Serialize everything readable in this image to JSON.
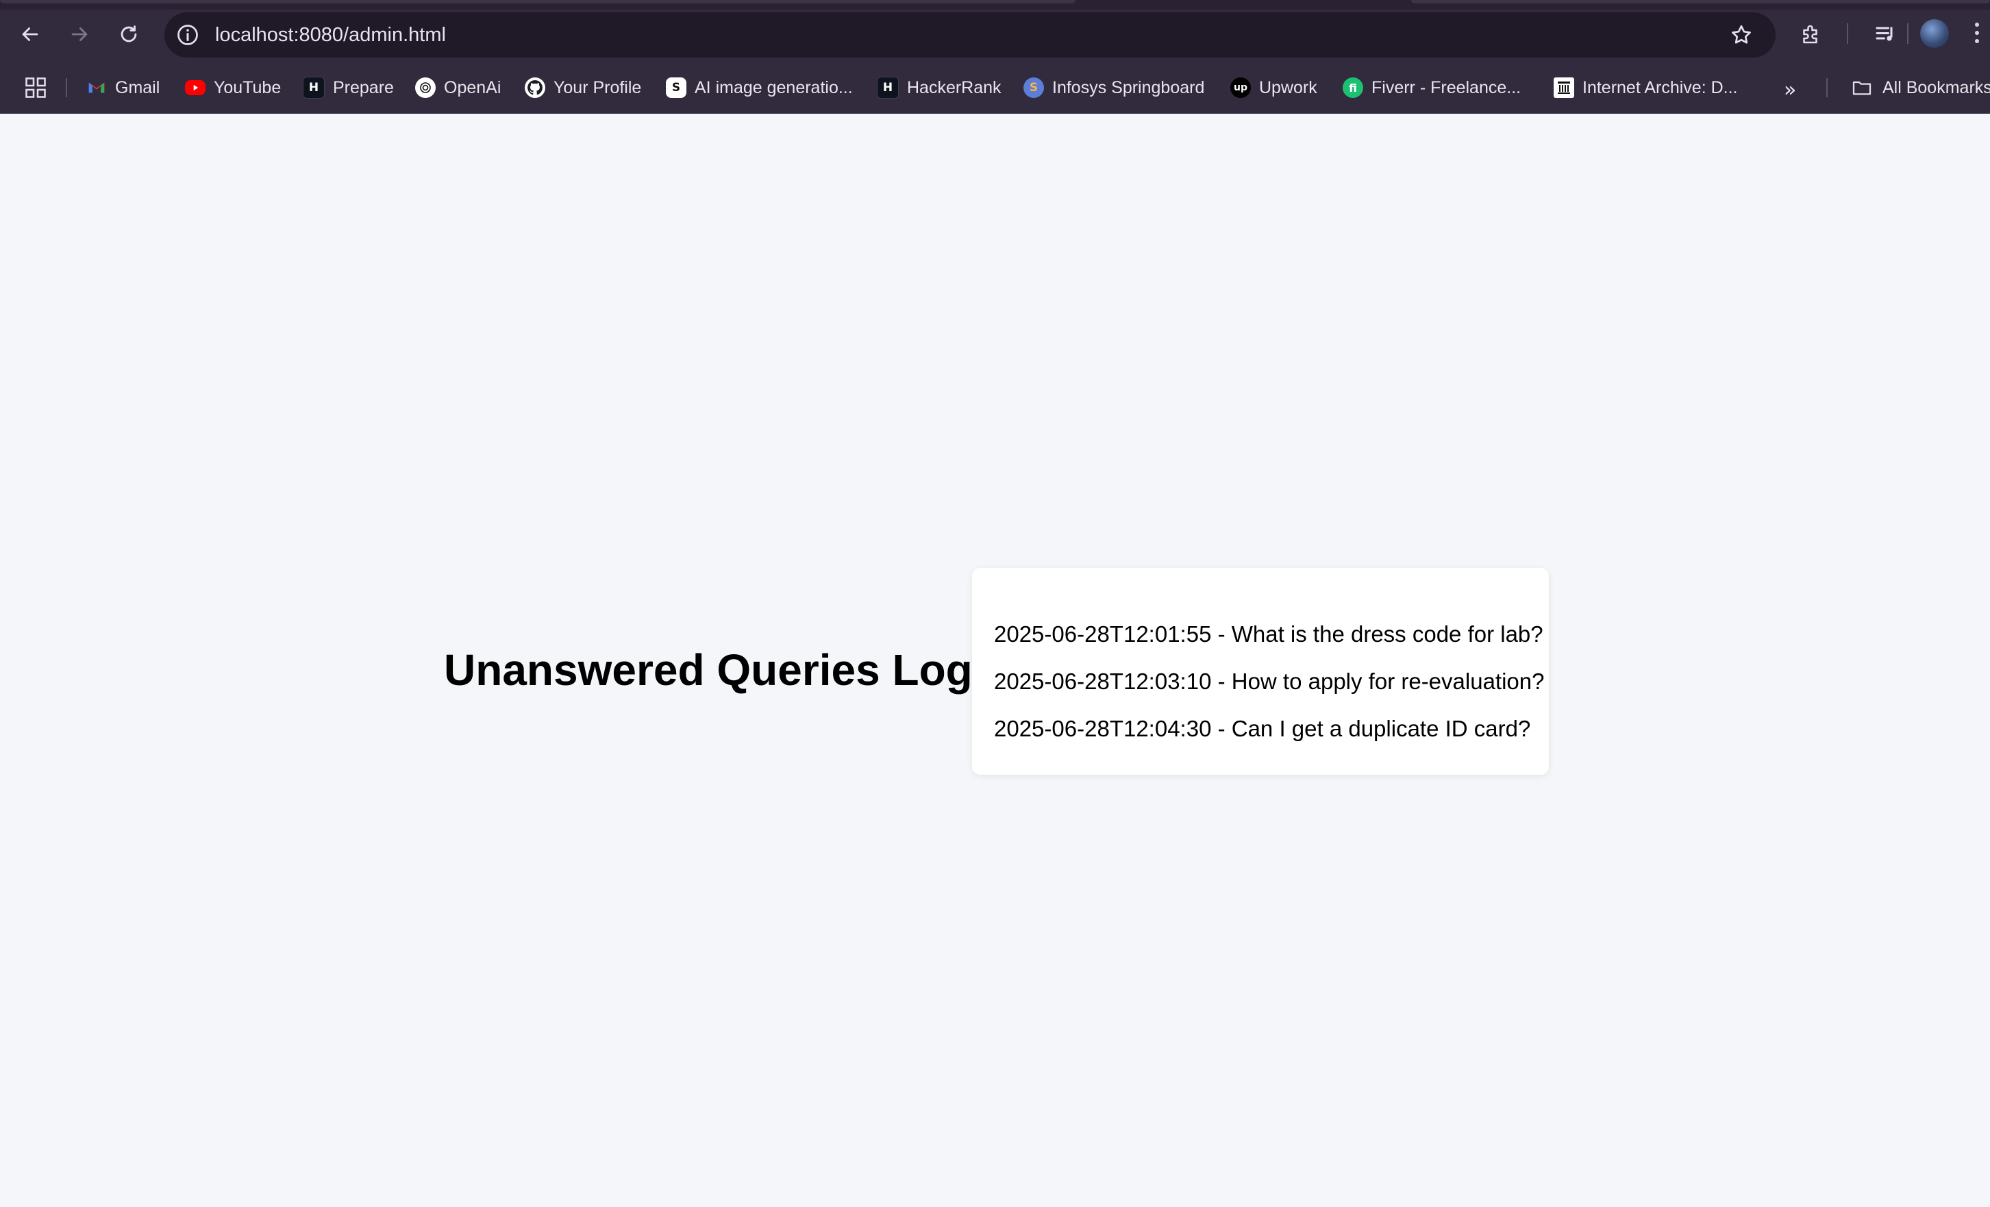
{
  "browser": {
    "url": "localhost:8080/admin.html",
    "bookmarks": [
      {
        "label": "Gmail",
        "icon": "gmail-icon"
      },
      {
        "label": "YouTube",
        "icon": "youtube-icon"
      },
      {
        "label": "Prepare",
        "icon": "hackerrank-icon"
      },
      {
        "label": "OpenAi",
        "icon": "openai-icon"
      },
      {
        "label": "Your Profile",
        "icon": "github-icon"
      },
      {
        "label": "AI image generatio...",
        "icon": "s-logo-icon"
      },
      {
        "label": "HackerRank",
        "icon": "hackerrank-icon"
      },
      {
        "label": "Infosys Springboard",
        "icon": "infosys-springboard-icon"
      },
      {
        "label": "Upwork",
        "icon": "upwork-icon"
      },
      {
        "label": "Fiverr - Freelance...",
        "icon": "fiverr-icon"
      },
      {
        "label": "Internet Archive: D...",
        "icon": "internet-archive-icon"
      }
    ],
    "more_label": "»",
    "all_bookmarks_label": "All Bookmarks",
    "colors": {
      "chrome_bg": "#322a3d",
      "omnibox_bg": "#201a28"
    }
  },
  "page": {
    "title": "Unanswered Queries Log",
    "background": "#f4f6f9",
    "queries": [
      "2025-06-28T12:01:55 - What is the dress code for lab?",
      "2025-06-28T12:03:10 - How to apply for re-evaluation?",
      "2025-06-28T12:04:30 - Can I get a duplicate ID card?"
    ]
  }
}
